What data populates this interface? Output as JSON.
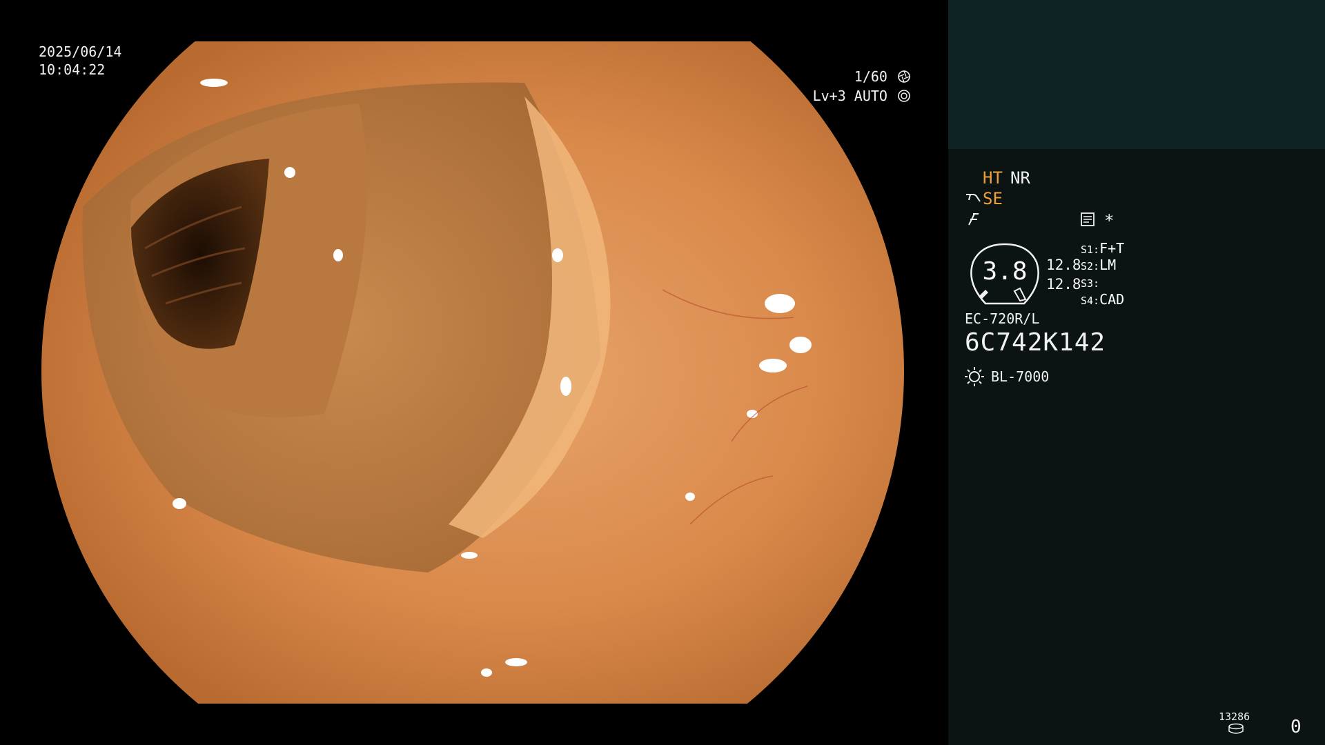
{
  "video": {
    "date": "2025/06/14",
    "time": "10:04:22",
    "shutter": "1/60",
    "level": "Lv+3 AUTO"
  },
  "panel": {
    "ht": "HT",
    "nr": "NR",
    "se": "SE",
    "asterisk": "*",
    "gauge_value": "3.8",
    "ratio_1": "12.8",
    "ratio_2": "12.8",
    "switches": [
      {
        "key": "S1:",
        "value": "F+T"
      },
      {
        "key": "S2:",
        "value": "LM"
      },
      {
        "key": "S3:",
        "value": ""
      },
      {
        "key": "S4:",
        "value": "CAD"
      }
    ],
    "scope_model": "EC-720R/L",
    "scope_serial": "6C742K142",
    "light_source": "BL-7000",
    "counter": "13286",
    "count_value": "0"
  },
  "colors": {
    "highlight": "#f0a23a",
    "panel_bg": "#0b1313",
    "panel_top_bg": "#0e2324"
  },
  "icons": [
    "shutter-icon",
    "auto-iris-icon",
    "structure-enhance-icon",
    "color-enhance-icon",
    "menu-icon",
    "light-source-icon",
    "media-icon"
  ]
}
